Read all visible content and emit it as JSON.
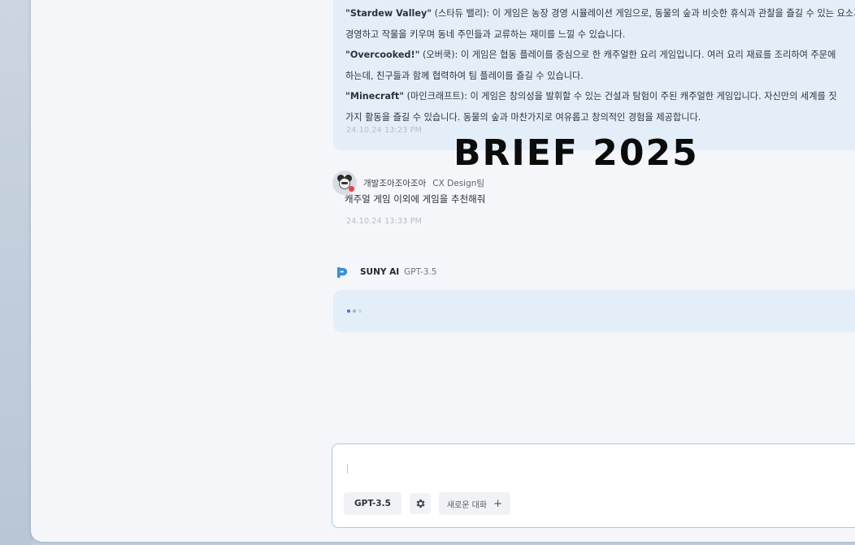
{
  "conversation": {
    "ai_message_1": {
      "lines": [
        {
          "game": "\"Stardew Valley\"",
          "rest": " (스타듀 밸리): 이 게임은 농장 경영 시뮬레이션 게임으로, 동물의 숲과 비슷한 휴식과 관찰을 즐길 수 있는 요소가 있습니다."
        },
        {
          "game": "",
          "rest": "경영하고 작물을 키우며 동네 주민들과 교류하는 재미를 느낄 수 있습니다."
        },
        {
          "game": "\"Overcooked!\"",
          "rest": " (오버쿡): 이 게임은 협동 플레이를 중심으로 한 캐주얼한 요리 게임입니다. 여러 요리 재료를 조리하여 주문에"
        },
        {
          "game": "",
          "rest": "하는데, 친구들과 함께 협력하여 팀 플레이를 즐길 수 있습니다."
        },
        {
          "game": "\"Minecraft\"",
          "rest": " (마인크래프트): 이 게임은 창의성을 발휘할 수 있는 건설과 탐험이 주된 캐주얼한 게임입니다. 자신만의 세계를 짓"
        },
        {
          "game": "",
          "rest": "가지 활동을 즐길 수 있습니다. 동물의 숲과 마찬가지로 여유롭고 창의적인 경험을 제공합니다."
        }
      ],
      "timestamp": "24.10.24 13:23 PM"
    },
    "user_message": {
      "author": "개발조아조아조아",
      "role": "CX Design팀",
      "text": "캐주얼 게임 이외에 게임을 추천해줘",
      "timestamp": "24.10.24 13:33 PM"
    },
    "ai_message_2": {
      "author": "SUNY AI",
      "model": "GPT-3.5"
    }
  },
  "overlay": {
    "watermark": "BRIEF 2025"
  },
  "composer": {
    "value": "",
    "placeholder": "",
    "model_label": "GPT-3.5",
    "new_chat_label": "새로운 대화",
    "new_chat_icon": "+"
  },
  "icons": {
    "settings": "gear-icon",
    "ai_logo": "suny-logo-icon",
    "user_avatar": "avatar"
  },
  "colors": {
    "ai_bubble": "#e4eef8",
    "composer_border": "#a9c6e6",
    "brand_logo": "#3b8fd1"
  }
}
